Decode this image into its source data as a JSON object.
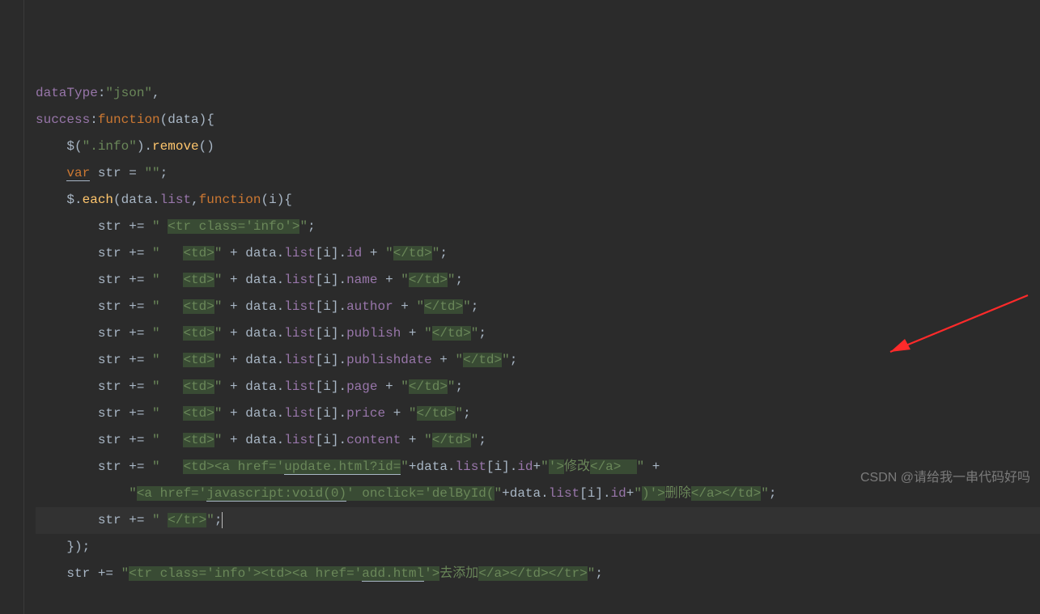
{
  "watermark": "CSDN @请给我一串代码好吗",
  "code": {
    "lines": [
      {
        "tokens": [
          {
            "t": "dataType",
            "c": "prop"
          },
          {
            "t": ":",
            "c": "op"
          },
          {
            "t": "\"json\"",
            "c": "str"
          },
          {
            "t": ",",
            "c": "op"
          }
        ]
      },
      {
        "tokens": [
          {
            "t": "success",
            "c": "prop"
          },
          {
            "t": ":",
            "c": "op"
          },
          {
            "t": "function",
            "c": "kw"
          },
          {
            "t": "(",
            "c": "paren"
          },
          {
            "t": "data",
            "c": "ident"
          },
          {
            "t": "){",
            "c": "paren"
          }
        ]
      },
      {
        "indent": 1,
        "tokens": [
          {
            "t": "$(",
            "c": "ident"
          },
          {
            "t": "\".info\"",
            "c": "str"
          },
          {
            "t": ").",
            "c": "op"
          },
          {
            "t": "remove",
            "c": "func"
          },
          {
            "t": "()",
            "c": "paren"
          }
        ]
      },
      {
        "indent": 1,
        "tokens": [
          {
            "t": "var",
            "c": "kw underline"
          },
          {
            "t": " str = ",
            "c": "op"
          },
          {
            "t": "\"\"",
            "c": "str"
          },
          {
            "t": ";",
            "c": "op"
          }
        ]
      },
      {
        "indent": 1,
        "tokens": [
          {
            "t": "$",
            "c": "ident"
          },
          {
            "t": ".",
            "c": "op"
          },
          {
            "t": "each",
            "c": "func"
          },
          {
            "t": "(",
            "c": "paren"
          },
          {
            "t": "data",
            "c": "ident"
          },
          {
            "t": ".",
            "c": "op"
          },
          {
            "t": "list",
            "c": "prop"
          },
          {
            "t": ",",
            "c": "op"
          },
          {
            "t": "function",
            "c": "kw"
          },
          {
            "t": "(",
            "c": "paren"
          },
          {
            "t": "i",
            "c": "ident"
          },
          {
            "t": "){",
            "c": "paren"
          }
        ]
      },
      {
        "indent": 2,
        "tokens": [
          {
            "t": "str += ",
            "c": "ident"
          },
          {
            "t": "\" ",
            "c": "str"
          },
          {
            "t": "<tr class='info'>",
            "c": "str hl"
          },
          {
            "t": "\"",
            "c": "str"
          },
          {
            "t": ";",
            "c": "op"
          }
        ]
      },
      {
        "indent": 2,
        "tokens": [
          {
            "t": "str += ",
            "c": "ident"
          },
          {
            "t": "\"   ",
            "c": "str"
          },
          {
            "t": "<td>",
            "c": "str hl"
          },
          {
            "t": "\"",
            "c": "str"
          },
          {
            "t": " + data.",
            "c": "op"
          },
          {
            "t": "list",
            "c": "prop"
          },
          {
            "t": "[i].",
            "c": "op"
          },
          {
            "t": "id",
            "c": "prop"
          },
          {
            "t": " + ",
            "c": "op"
          },
          {
            "t": "\"",
            "c": "str"
          },
          {
            "t": "</td>",
            "c": "str hl"
          },
          {
            "t": "\"",
            "c": "str"
          },
          {
            "t": ";",
            "c": "op"
          }
        ]
      },
      {
        "indent": 2,
        "tokens": [
          {
            "t": "str += ",
            "c": "ident"
          },
          {
            "t": "\"   ",
            "c": "str"
          },
          {
            "t": "<td>",
            "c": "str hl"
          },
          {
            "t": "\"",
            "c": "str"
          },
          {
            "t": " + data.",
            "c": "op"
          },
          {
            "t": "list",
            "c": "prop"
          },
          {
            "t": "[i].",
            "c": "op"
          },
          {
            "t": "name",
            "c": "prop"
          },
          {
            "t": " + ",
            "c": "op"
          },
          {
            "t": "\"",
            "c": "str"
          },
          {
            "t": "</td>",
            "c": "str hl"
          },
          {
            "t": "\"",
            "c": "str"
          },
          {
            "t": ";",
            "c": "op"
          }
        ]
      },
      {
        "indent": 2,
        "tokens": [
          {
            "t": "str += ",
            "c": "ident"
          },
          {
            "t": "\"   ",
            "c": "str"
          },
          {
            "t": "<td>",
            "c": "str hl"
          },
          {
            "t": "\"",
            "c": "str"
          },
          {
            "t": " + data.",
            "c": "op"
          },
          {
            "t": "list",
            "c": "prop"
          },
          {
            "t": "[i].",
            "c": "op"
          },
          {
            "t": "author",
            "c": "prop"
          },
          {
            "t": " + ",
            "c": "op"
          },
          {
            "t": "\"",
            "c": "str"
          },
          {
            "t": "</td>",
            "c": "str hl"
          },
          {
            "t": "\"",
            "c": "str"
          },
          {
            "t": ";",
            "c": "op"
          }
        ]
      },
      {
        "indent": 2,
        "tokens": [
          {
            "t": "str += ",
            "c": "ident"
          },
          {
            "t": "\"   ",
            "c": "str"
          },
          {
            "t": "<td>",
            "c": "str hl"
          },
          {
            "t": "\"",
            "c": "str"
          },
          {
            "t": " + data.",
            "c": "op"
          },
          {
            "t": "list",
            "c": "prop"
          },
          {
            "t": "[i].",
            "c": "op"
          },
          {
            "t": "publish",
            "c": "prop"
          },
          {
            "t": " + ",
            "c": "op"
          },
          {
            "t": "\"",
            "c": "str"
          },
          {
            "t": "</td>",
            "c": "str hl"
          },
          {
            "t": "\"",
            "c": "str"
          },
          {
            "t": ";",
            "c": "op"
          }
        ]
      },
      {
        "indent": 2,
        "tokens": [
          {
            "t": "str += ",
            "c": "ident"
          },
          {
            "t": "\"   ",
            "c": "str"
          },
          {
            "t": "<td>",
            "c": "str hl"
          },
          {
            "t": "\"",
            "c": "str"
          },
          {
            "t": " + data.",
            "c": "op"
          },
          {
            "t": "list",
            "c": "prop"
          },
          {
            "t": "[i].",
            "c": "op"
          },
          {
            "t": "publishdate",
            "c": "prop"
          },
          {
            "t": " + ",
            "c": "op"
          },
          {
            "t": "\"",
            "c": "str"
          },
          {
            "t": "</td>",
            "c": "str hl"
          },
          {
            "t": "\"",
            "c": "str"
          },
          {
            "t": ";",
            "c": "op"
          }
        ]
      },
      {
        "indent": 2,
        "tokens": [
          {
            "t": "str += ",
            "c": "ident"
          },
          {
            "t": "\"   ",
            "c": "str"
          },
          {
            "t": "<td>",
            "c": "str hl"
          },
          {
            "t": "\"",
            "c": "str"
          },
          {
            "t": " + data.",
            "c": "op"
          },
          {
            "t": "list",
            "c": "prop"
          },
          {
            "t": "[i].",
            "c": "op"
          },
          {
            "t": "page",
            "c": "prop"
          },
          {
            "t": " + ",
            "c": "op"
          },
          {
            "t": "\"",
            "c": "str"
          },
          {
            "t": "</td>",
            "c": "str hl"
          },
          {
            "t": "\"",
            "c": "str"
          },
          {
            "t": ";",
            "c": "op"
          }
        ]
      },
      {
        "indent": 2,
        "tokens": [
          {
            "t": "str += ",
            "c": "ident"
          },
          {
            "t": "\"   ",
            "c": "str"
          },
          {
            "t": "<td>",
            "c": "str hl"
          },
          {
            "t": "\"",
            "c": "str"
          },
          {
            "t": " + data.",
            "c": "op"
          },
          {
            "t": "list",
            "c": "prop"
          },
          {
            "t": "[i].",
            "c": "op"
          },
          {
            "t": "price",
            "c": "prop"
          },
          {
            "t": " + ",
            "c": "op"
          },
          {
            "t": "\"",
            "c": "str"
          },
          {
            "t": "</td>",
            "c": "str hl"
          },
          {
            "t": "\"",
            "c": "str"
          },
          {
            "t": ";",
            "c": "op"
          }
        ]
      },
      {
        "indent": 2,
        "tokens": [
          {
            "t": "str += ",
            "c": "ident"
          },
          {
            "t": "\"   ",
            "c": "str"
          },
          {
            "t": "<td>",
            "c": "str hl"
          },
          {
            "t": "\"",
            "c": "str"
          },
          {
            "t": " + data.",
            "c": "op"
          },
          {
            "t": "list",
            "c": "prop"
          },
          {
            "t": "[i].",
            "c": "op"
          },
          {
            "t": "content",
            "c": "prop"
          },
          {
            "t": " + ",
            "c": "op"
          },
          {
            "t": "\"",
            "c": "str"
          },
          {
            "t": "</td>",
            "c": "str hl"
          },
          {
            "t": "\"",
            "c": "str"
          },
          {
            "t": ";",
            "c": "op"
          }
        ]
      },
      {
        "indent": 2,
        "tokens": [
          {
            "t": "str += ",
            "c": "ident"
          },
          {
            "t": "\"   ",
            "c": "str"
          },
          {
            "t": "<td><a href='",
            "c": "str hl"
          },
          {
            "t": "update.html?id=",
            "c": "str hl underline"
          },
          {
            "t": "\"",
            "c": "str"
          },
          {
            "t": "+data.",
            "c": "op"
          },
          {
            "t": "list",
            "c": "prop"
          },
          {
            "t": "[i].",
            "c": "op"
          },
          {
            "t": "id",
            "c": "prop"
          },
          {
            "t": "+",
            "c": "op"
          },
          {
            "t": "\"",
            "c": "str"
          },
          {
            "t": "'>",
            "c": "str hl"
          },
          {
            "t": "修改",
            "c": "str"
          },
          {
            "t": "</a>  ",
            "c": "str hl"
          },
          {
            "t": "\"",
            "c": "str"
          },
          {
            "t": " +",
            "c": "op"
          }
        ]
      },
      {
        "indent": 3,
        "tokens": [
          {
            "t": "\"",
            "c": "str"
          },
          {
            "t": "<a href='",
            "c": "str hl"
          },
          {
            "t": "javascript:void(0)",
            "c": "str hl underline"
          },
          {
            "t": "' onclick='delById(",
            "c": "str hl"
          },
          {
            "t": "\"",
            "c": "str"
          },
          {
            "t": "+data.",
            "c": "op"
          },
          {
            "t": "list",
            "c": "prop"
          },
          {
            "t": "[i].",
            "c": "op"
          },
          {
            "t": "id",
            "c": "prop"
          },
          {
            "t": "+",
            "c": "op"
          },
          {
            "t": "\"",
            "c": "str"
          },
          {
            "t": ")'>",
            "c": "str hl"
          },
          {
            "t": "删除",
            "c": "str"
          },
          {
            "t": "</a></td>",
            "c": "str hl"
          },
          {
            "t": "\"",
            "c": "str"
          },
          {
            "t": ";",
            "c": "op"
          }
        ]
      },
      {
        "indent": 2,
        "current": true,
        "tokens": [
          {
            "t": "str += ",
            "c": "ident"
          },
          {
            "t": "\" ",
            "c": "str"
          },
          {
            "t": "</tr>",
            "c": "str hl"
          },
          {
            "t": "\"",
            "c": "str"
          },
          {
            "t": ";",
            "c": "op"
          },
          {
            "t": "",
            "c": "caret-mark"
          }
        ]
      },
      {
        "indent": 1,
        "tokens": [
          {
            "t": "});",
            "c": "op"
          }
        ]
      },
      {
        "indent": 1,
        "tokens": [
          {
            "t": "str += ",
            "c": "ident"
          },
          {
            "t": "\"",
            "c": "str"
          },
          {
            "t": "<tr class='info'><td><a href='",
            "c": "str hl"
          },
          {
            "t": "add.html",
            "c": "str hl underline"
          },
          {
            "t": "'>",
            "c": "str hl"
          },
          {
            "t": "去添加",
            "c": "str"
          },
          {
            "t": "</a></td></tr>",
            "c": "str hl"
          },
          {
            "t": "\"",
            "c": "str"
          },
          {
            "t": ";",
            "c": "op"
          }
        ]
      }
    ]
  }
}
